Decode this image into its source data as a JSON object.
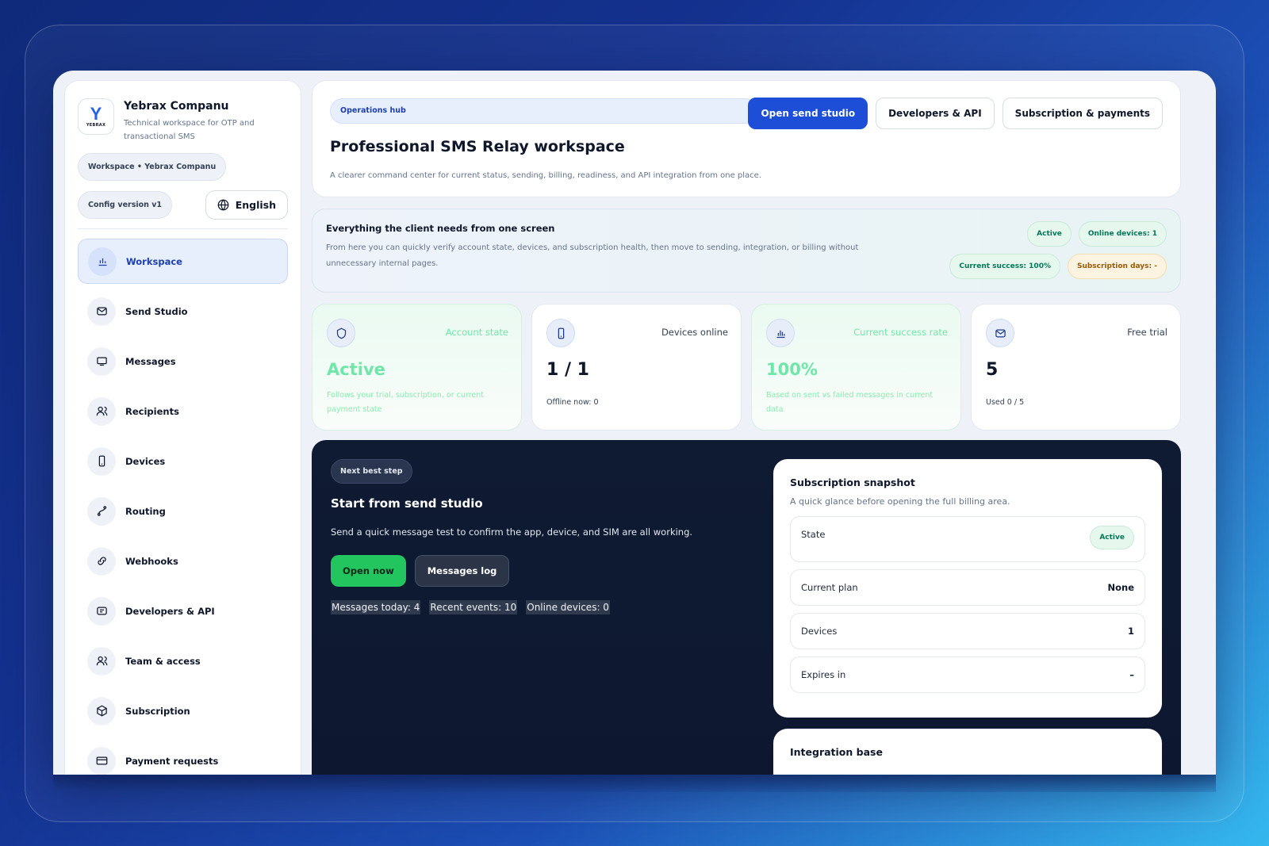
{
  "brand": {
    "name": "Yebrax Companu",
    "subtitle": "Technical workspace for OTP and transactional SMS",
    "logo_letter": "Y",
    "logo_text": "YEBRAX"
  },
  "sidebar": {
    "workspace_chip": "Workspace • Yebrax Companu",
    "config_chip": "Config version v1",
    "language": "English",
    "items": [
      {
        "label": "Workspace",
        "icon": "chart-icon"
      },
      {
        "label": "Send Studio",
        "icon": "mail-icon"
      },
      {
        "label": "Messages",
        "icon": "inbox-icon"
      },
      {
        "label": "Recipients",
        "icon": "users-icon"
      },
      {
        "label": "Devices",
        "icon": "phone-icon"
      },
      {
        "label": "Routing",
        "icon": "route-icon"
      },
      {
        "label": "Webhooks",
        "icon": "webhook-icon"
      },
      {
        "label": "Developers & API",
        "icon": "code-icon"
      },
      {
        "label": "Team & access",
        "icon": "team-icon"
      },
      {
        "label": "Subscription",
        "icon": "box-icon"
      },
      {
        "label": "Payment requests",
        "icon": "card-icon"
      }
    ]
  },
  "header": {
    "pill": "Operations hub",
    "title": "Professional SMS Relay workspace",
    "subtitle": "A clearer command center for current status, sending, billing, readiness, and API integration from one place.",
    "actions": {
      "send_studio": "Open send studio",
      "developers": "Developers & API",
      "subscription": "Subscription & payments"
    }
  },
  "summary": {
    "title": "Everything the client needs from one screen",
    "text": "From here you can quickly verify account state, devices, and subscription health, then move to sending, integration, or billing without unnecessary internal pages.",
    "badges": {
      "active": "Active",
      "online": "Online devices: 1",
      "success": "Current success: 100%",
      "days": "Subscription days: -"
    }
  },
  "stats": {
    "account": {
      "label": "Account state",
      "value": "Active",
      "foot": "Follows your trial, subscription, or current payment state"
    },
    "devices": {
      "label": "Devices online",
      "value": "1 / 1",
      "foot": "Offline now: 0"
    },
    "success": {
      "label": "Current success rate",
      "value": "100%",
      "foot": "Based on sent vs failed messages in current data"
    },
    "trial": {
      "label": "Free trial",
      "value": "5",
      "foot": "Used 0 / 5"
    }
  },
  "next_step": {
    "pill": "Next best step",
    "title": "Start from send studio",
    "subtitle": "Send a quick message test to confirm the app, device, and SIM are all working.",
    "open_now": "Open now",
    "messages_log": "Messages log",
    "messages_today": "Messages today: 4",
    "recent_events": "Recent events: 10",
    "online_devices": "Online devices: 0"
  },
  "snapshot": {
    "title": "Subscription snapshot",
    "subtitle": "A quick glance before opening the full billing area.",
    "state_label": "State",
    "state_value": "Active",
    "plan_label": "Current plan",
    "plan_value": "None",
    "devices_label": "Devices",
    "devices_value": "1",
    "expires_label": "Expires in",
    "expires_value": "–"
  },
  "integration": {
    "title": "Integration base"
  },
  "colors": {
    "primary": "#1d4ed8",
    "success": "#22c55e",
    "dark_panel": "#0f1a33"
  }
}
